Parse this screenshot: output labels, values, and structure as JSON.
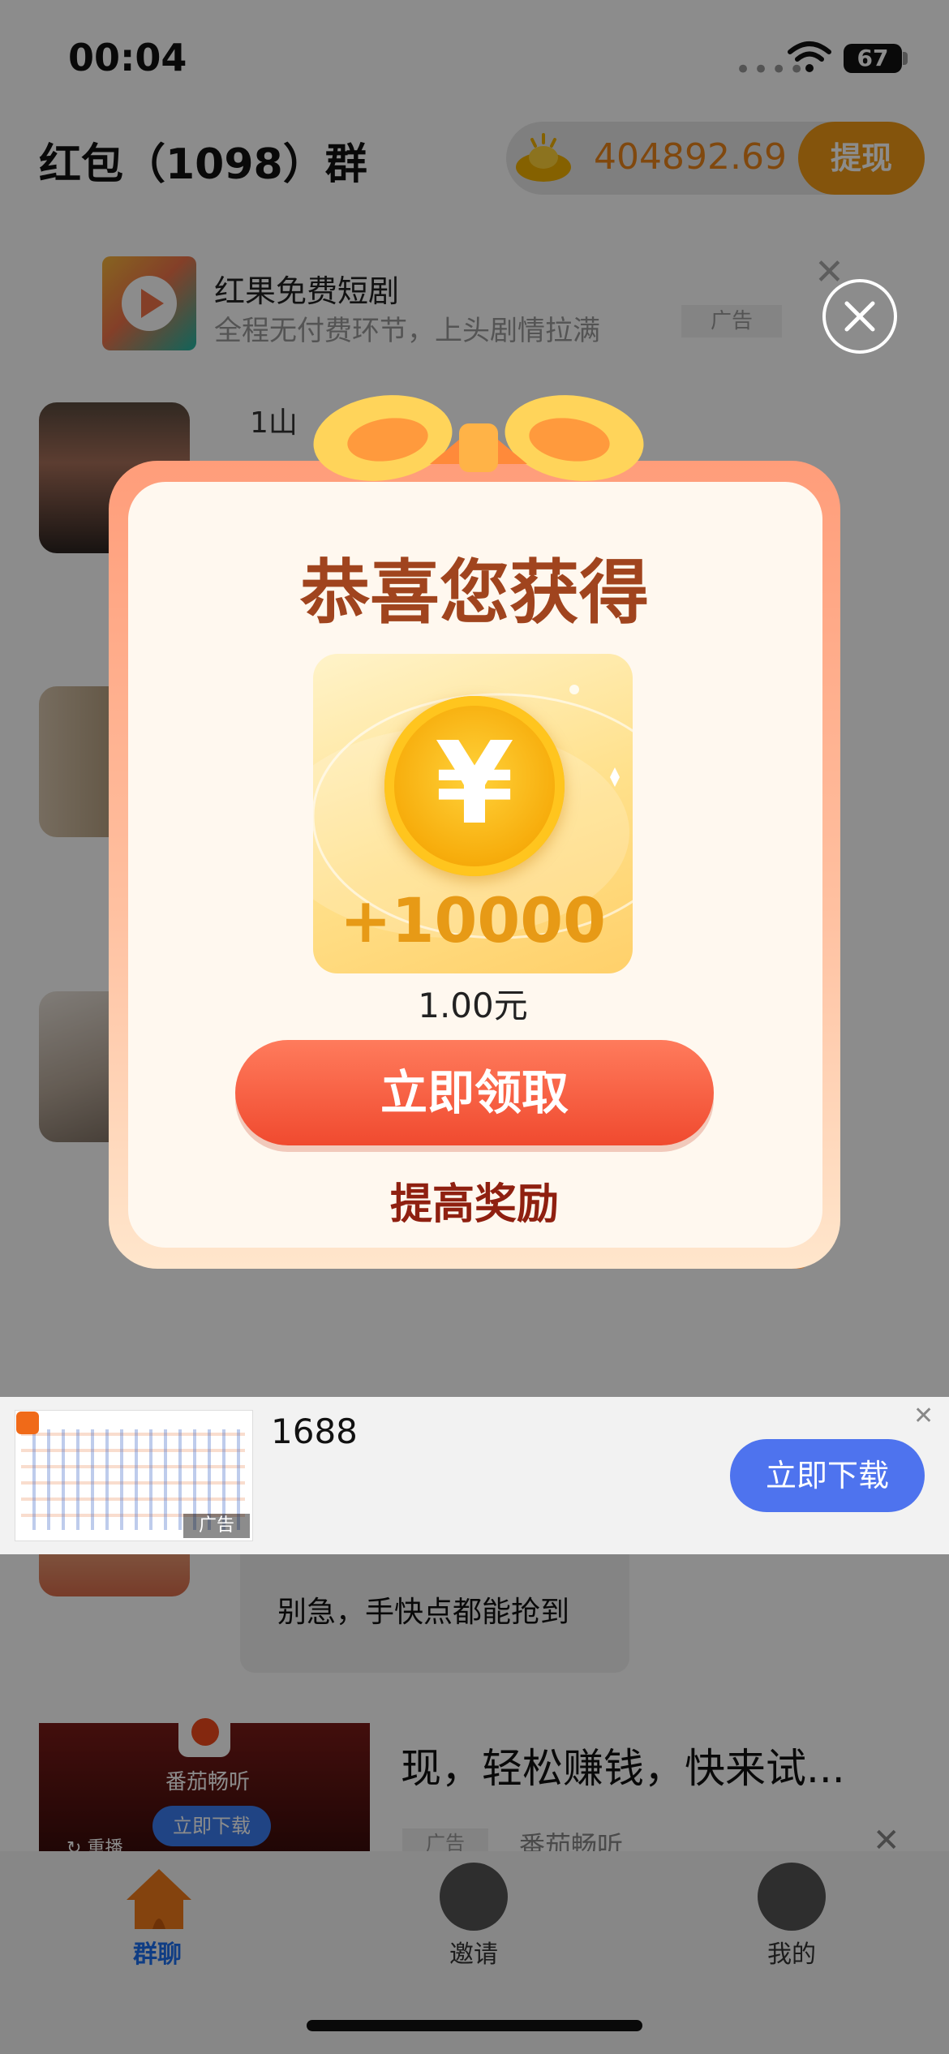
{
  "status_bar": {
    "time": "00:04",
    "battery": "67"
  },
  "header": {
    "title": "红包（1098）群",
    "coin_balance": "404892.69",
    "withdraw_label": "提现"
  },
  "top_ad": {
    "title": "红果免费短剧",
    "subtitle": "全程无付费环节，上头剧情拉满",
    "tag": "广告"
  },
  "chat": {
    "sender_name": "1山",
    "bubble_text": "别急，手快点都能抢到"
  },
  "feed_ad": {
    "text": "现，轻松赚钱，快来试...",
    "tag": "广告",
    "source": "番茄畅听",
    "app_name": "番茄畅听",
    "download_label": "立即下载",
    "replay_label": "重播"
  },
  "tabbar": {
    "items": [
      {
        "label": "群聊",
        "active": true
      },
      {
        "label": "邀请"
      },
      {
        "label": "我的"
      }
    ]
  },
  "bottom_ad": {
    "title": "1688",
    "button_label": "立即下载",
    "tag": "广告"
  },
  "popup": {
    "title": "恭喜您获得",
    "reward_amount": "+10000",
    "reward_value": "1.00元",
    "claim_label": "立即领取",
    "boost_label": "提高奖励",
    "coin_symbol": "¥"
  },
  "colors": {
    "accent_orange": "#f09a17",
    "claim_red": "#f04a2f",
    "active_tab_blue": "#1d6ff0",
    "download_blue": "#4e73ee"
  }
}
